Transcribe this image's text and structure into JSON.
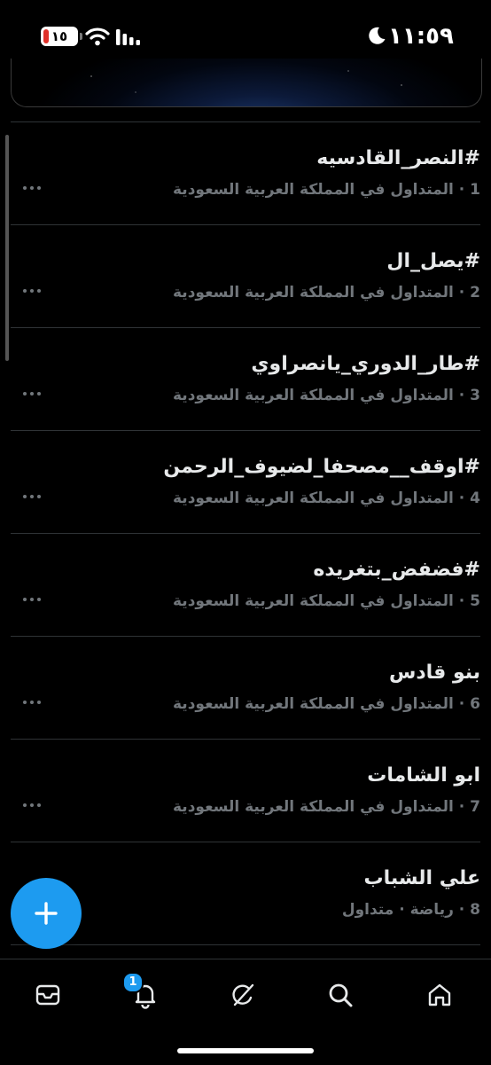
{
  "status_bar": {
    "time": "١١:٥٩",
    "battery_level": "١٥",
    "icons": [
      "battery-icon",
      "wifi-icon",
      "cellular-signal-icon",
      "moon-icon"
    ]
  },
  "trends": [
    {
      "title": "#النصر_القادسيه",
      "meta": "1 · المتداول في المملكة العربية السعودية"
    },
    {
      "title": "#يصل_ال",
      "meta": "2 · المتداول في المملكة العربية السعودية"
    },
    {
      "title": "#طار_الدوري_يانصراوي",
      "meta": "3 · المتداول في المملكة العربية السعودية"
    },
    {
      "title": "#اوقف__مصحفا_لضيوف_الرحمن",
      "meta": "4 · المتداول في المملكة العربية السعودية"
    },
    {
      "title": "#فضفض_بتغريده",
      "meta": "5 · المتداول في المملكة العربية السعودية"
    },
    {
      "title": "بنو قادس",
      "meta": "6 · المتداول في المملكة العربية السعودية"
    },
    {
      "title": "ابو الشامات",
      "meta": "7 · المتداول في المملكة العربية السعودية"
    },
    {
      "title": "علي الشباب",
      "meta": "8 · رياضة · متداول"
    }
  ],
  "bottom_nav": {
    "items": [
      "messages-icon",
      "notifications-icon",
      "grok-icon",
      "search-icon",
      "home-icon"
    ],
    "notification_badge": "1"
  },
  "colors": {
    "accent": "#1d9bf0",
    "background": "#000000",
    "primary_text": "#e7e9ea",
    "secondary_text": "#71767b",
    "divider": "#2f3336"
  }
}
